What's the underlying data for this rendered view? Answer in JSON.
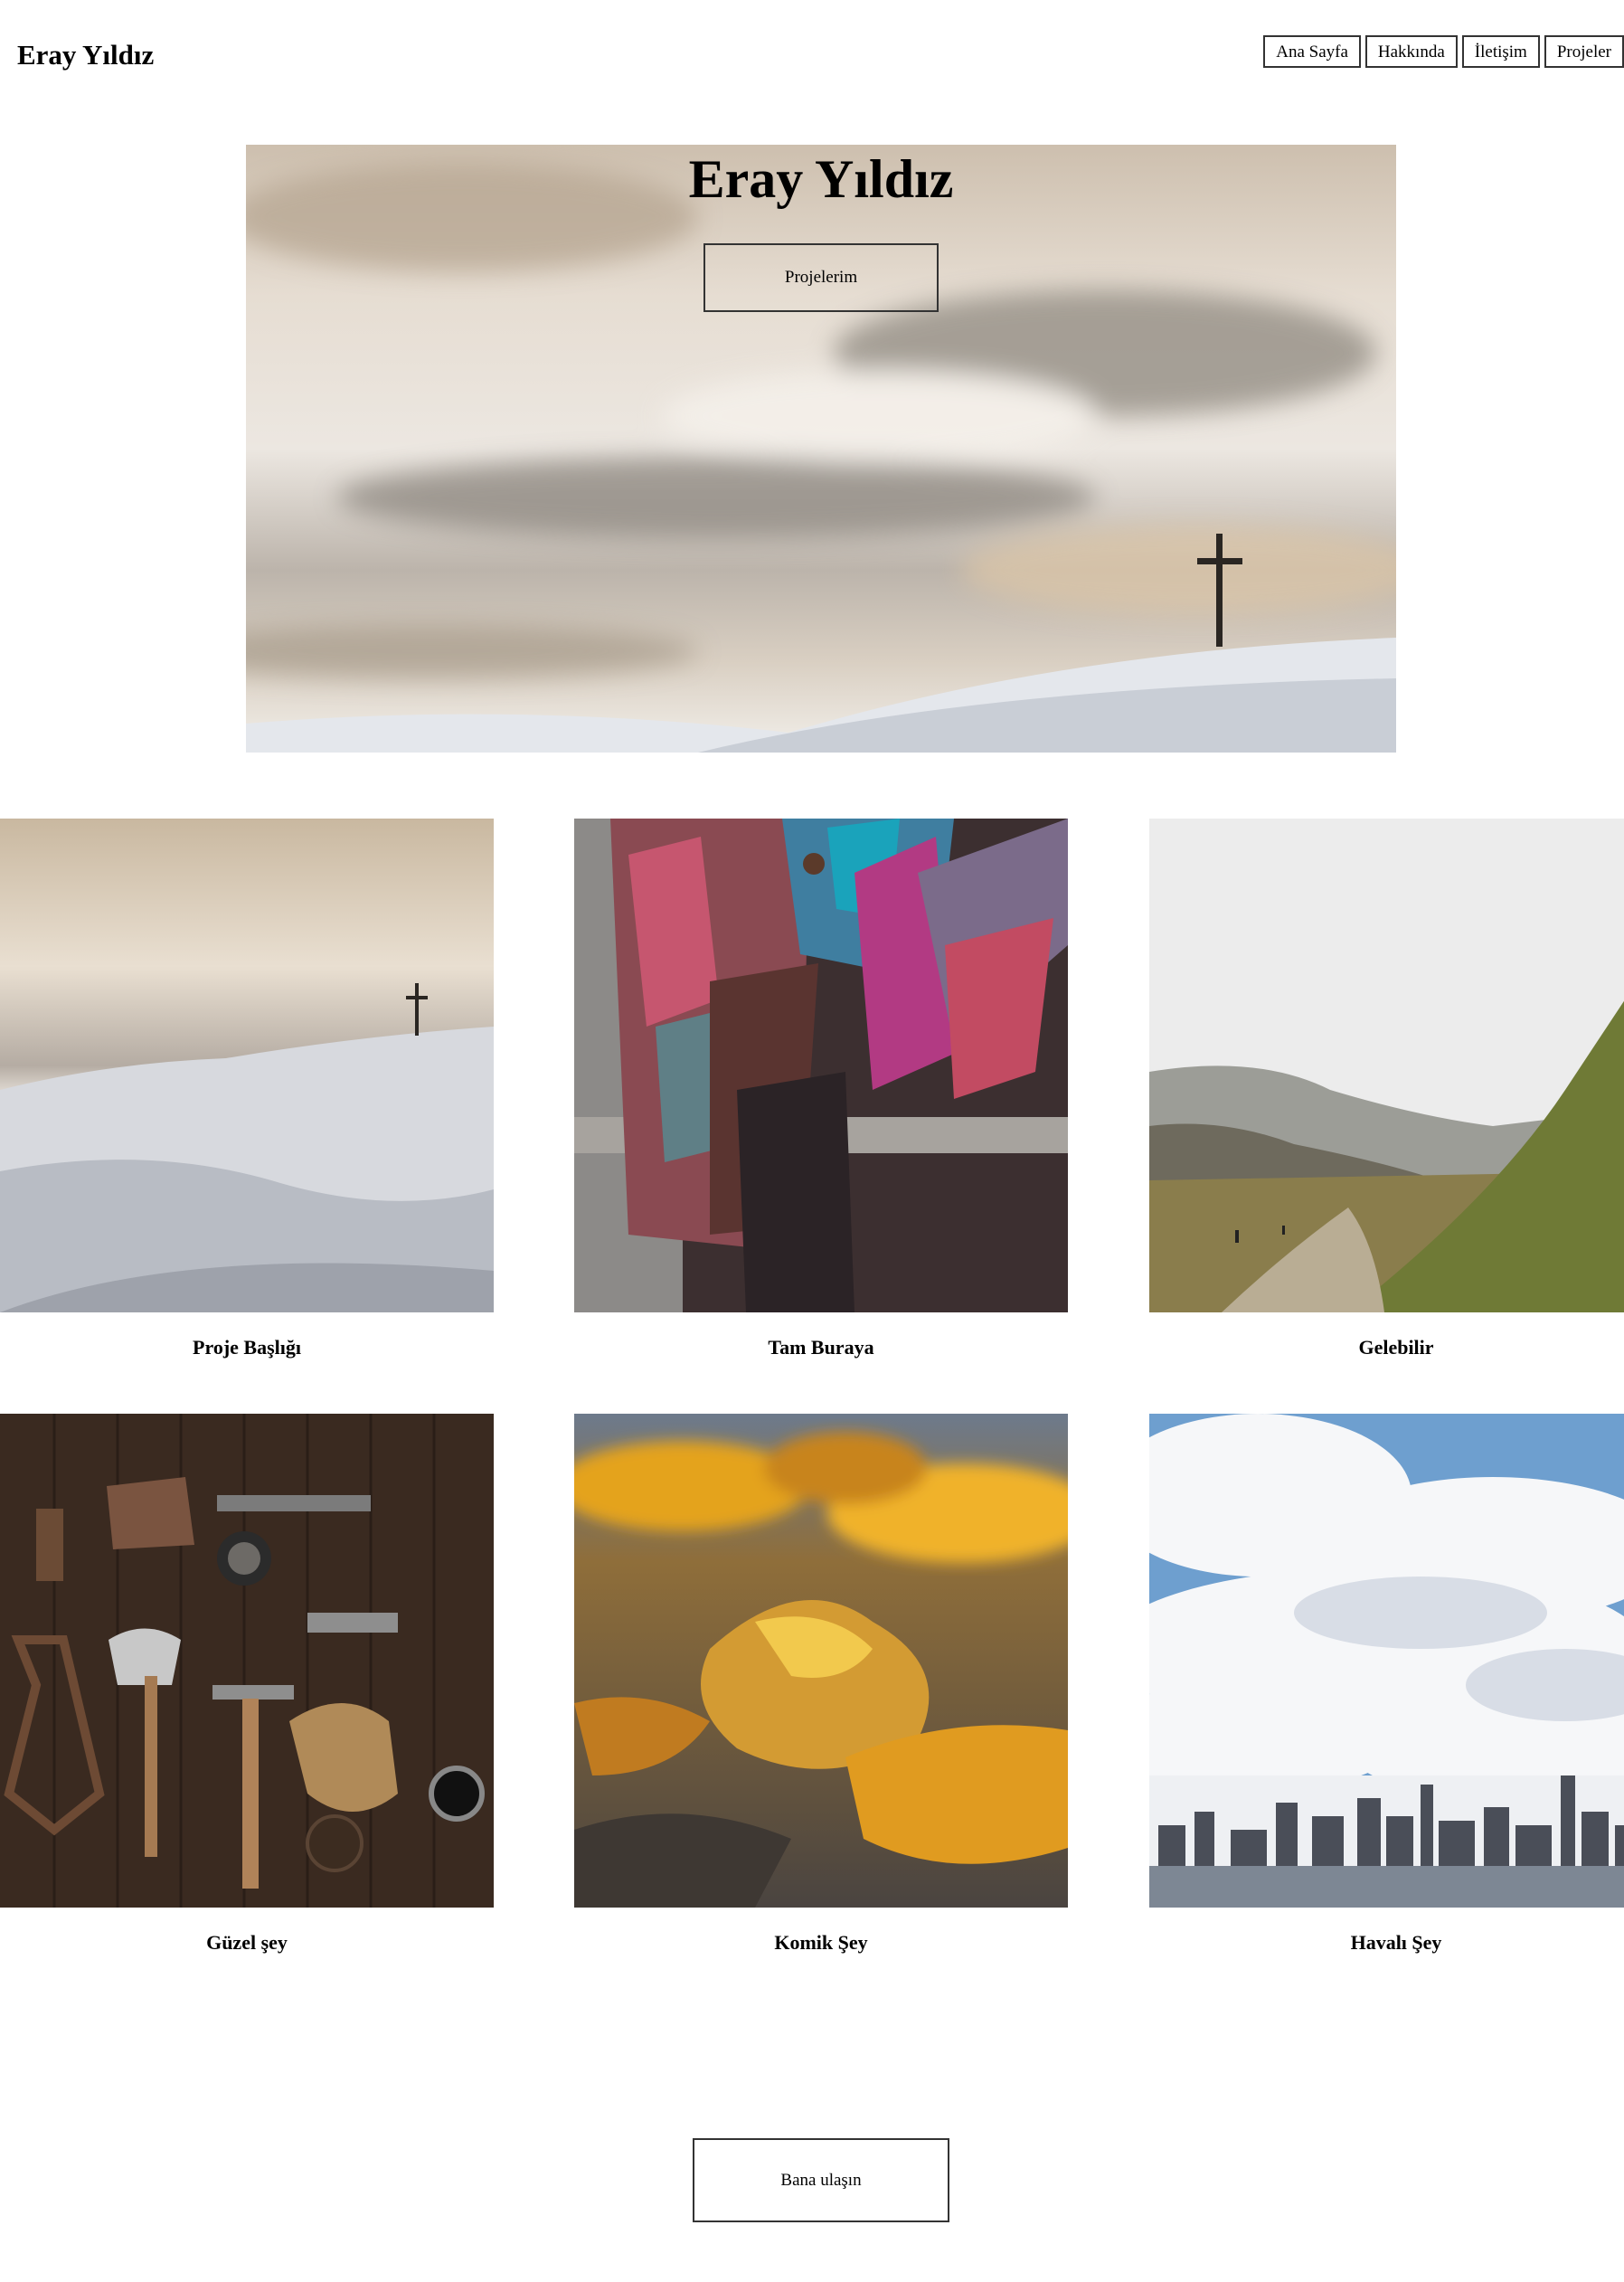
{
  "header": {
    "brand": "Eray Yıldız",
    "nav": [
      "Ana Sayfa",
      "Hakkında",
      "İletişim",
      "Projeler"
    ]
  },
  "hero": {
    "title": "Eray Yıldız",
    "button": "Projelerim"
  },
  "projects": [
    {
      "title": "Proje Başlığı",
      "image": "snowy-mountain-cross"
    },
    {
      "title": "Tam Buraya",
      "image": "colorful-poncho"
    },
    {
      "title": "Gelebilir",
      "image": "mountain-valley-trail"
    },
    {
      "title": "Güzel şey",
      "image": "vintage-tools-on-wood"
    },
    {
      "title": "Komik Şey",
      "image": "autumn-leaves"
    },
    {
      "title": "Havalı Şey",
      "image": "city-skyline-clouds"
    }
  ],
  "footer": {
    "contact_button": "Bana ulaşın"
  }
}
